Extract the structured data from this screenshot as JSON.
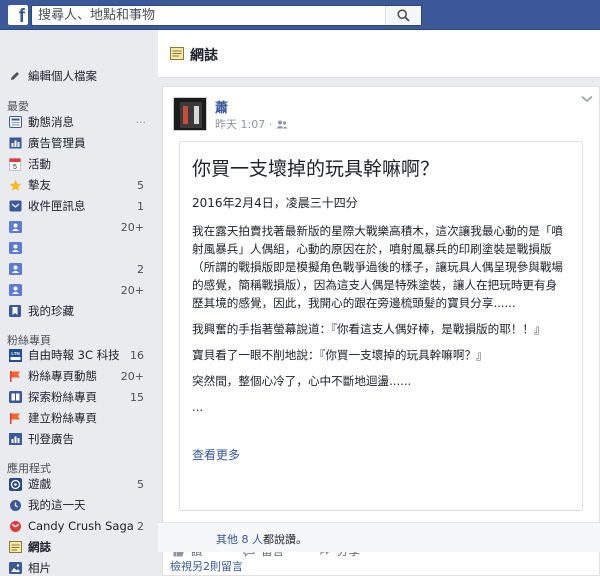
{
  "topbar": {
    "logo": "f",
    "search_placeholder": "搜尋人、地點和事物"
  },
  "sidebar": {
    "profile": "編輯個人檔案",
    "favorites_head": "最愛",
    "favorites": [
      {
        "label": "動態消息",
        "count": ""
      },
      {
        "label": "廣告管理員",
        "count": ""
      },
      {
        "label": "活動",
        "count": ""
      },
      {
        "label": "摯友",
        "count": "5"
      },
      {
        "label": "收件匣訊息",
        "count": "1"
      },
      {
        "label": "",
        "count": "20+"
      },
      {
        "label": "",
        "count": ""
      },
      {
        "label": "",
        "count": "2"
      },
      {
        "label": "",
        "count": "20+"
      },
      {
        "label": "我的珍藏",
        "count": ""
      }
    ],
    "pages_head": "粉絲專頁",
    "pages": [
      {
        "label": "自由時報 3C 科技",
        "count": "16"
      },
      {
        "label": "粉絲專頁動態",
        "count": "20+"
      },
      {
        "label": "探索粉絲專頁",
        "count": "15"
      },
      {
        "label": "建立粉絲專頁",
        "count": ""
      },
      {
        "label": "刊登廣告",
        "count": ""
      }
    ],
    "apps_head": "應用程式",
    "apps": [
      {
        "label": "遊戲",
        "count": "5"
      },
      {
        "label": "我的這一天",
        "count": ""
      },
      {
        "label": "Candy Crush Saga",
        "count": "2"
      },
      {
        "label": "網誌",
        "count": ""
      },
      {
        "label": "相片",
        "count": ""
      }
    ]
  },
  "header": {
    "title": "網誌"
  },
  "post": {
    "author": "蕭",
    "time": "昨天 1:07 ·",
    "note_title": "你買一支壞掉的玩具幹嘛啊？",
    "note_date": "2016年2月4日，凌晨三十四分",
    "paragraphs": [
      "我在露天拍賣找著最新版的星際大戰樂高積木，這次讓我最心動的是「噴射風暴兵」人偶組，心動的原因在於，噴射風暴兵的印刷塗裝是戰損版（所謂的戰損版即是模擬角色戰爭過後的樣子，讓玩具人偶呈現參與戰場的感覺，簡稱戰損版），因為這支人偶是特殊塗裝，讓人在把玩時更有身歷其境的感覺，因此，我開心的跟在旁邊梳頭髮的寶貝分享......",
      "我興奮的手指著螢幕說道：『你看這支人偶好棒，是戰損版的耶！！』",
      "寶貝看了一眼不削地說：『你買一支壞掉的玩具幹嘛啊？』",
      "突然間，整個心冷了，心中不斷地迴盪......",
      "..."
    ],
    "see_more": "查看更多",
    "actions": {
      "like": "讚",
      "comment": "留言",
      "share": "分享"
    },
    "likes_link": "其他 8 人",
    "likes_rest": "都說讚。",
    "more_comments": "檢視另2則留言"
  }
}
